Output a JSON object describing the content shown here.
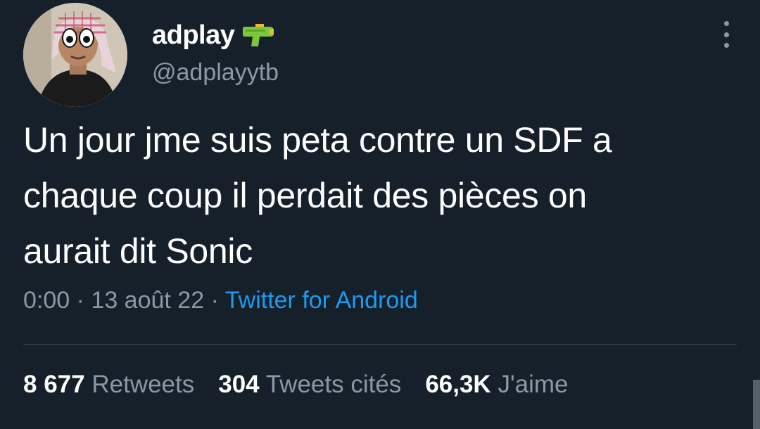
{
  "author": {
    "display_name": "adplay",
    "handle": "@adplayytb",
    "name_emoji": "water-pistol-icon"
  },
  "tweet": {
    "text": "Un jour jme suis peta contre un SDF a\nchaque coup il perdait des pièces on\naurait dit Sonic",
    "time": "0:00",
    "separator": "·",
    "date": "13 août 22",
    "source": "Twitter for Android"
  },
  "stats": {
    "retweets_count": "8 677",
    "retweets_label": "Retweets",
    "quotes_count": "304",
    "quotes_label": "Tweets cités",
    "likes_count": "66,3K",
    "likes_label": "J'aime"
  },
  "colors": {
    "background": "#15202b",
    "primary_text": "#ffffff",
    "secondary_text": "#8b98a5",
    "link": "#1d9bf0",
    "divider": "#38444d"
  }
}
